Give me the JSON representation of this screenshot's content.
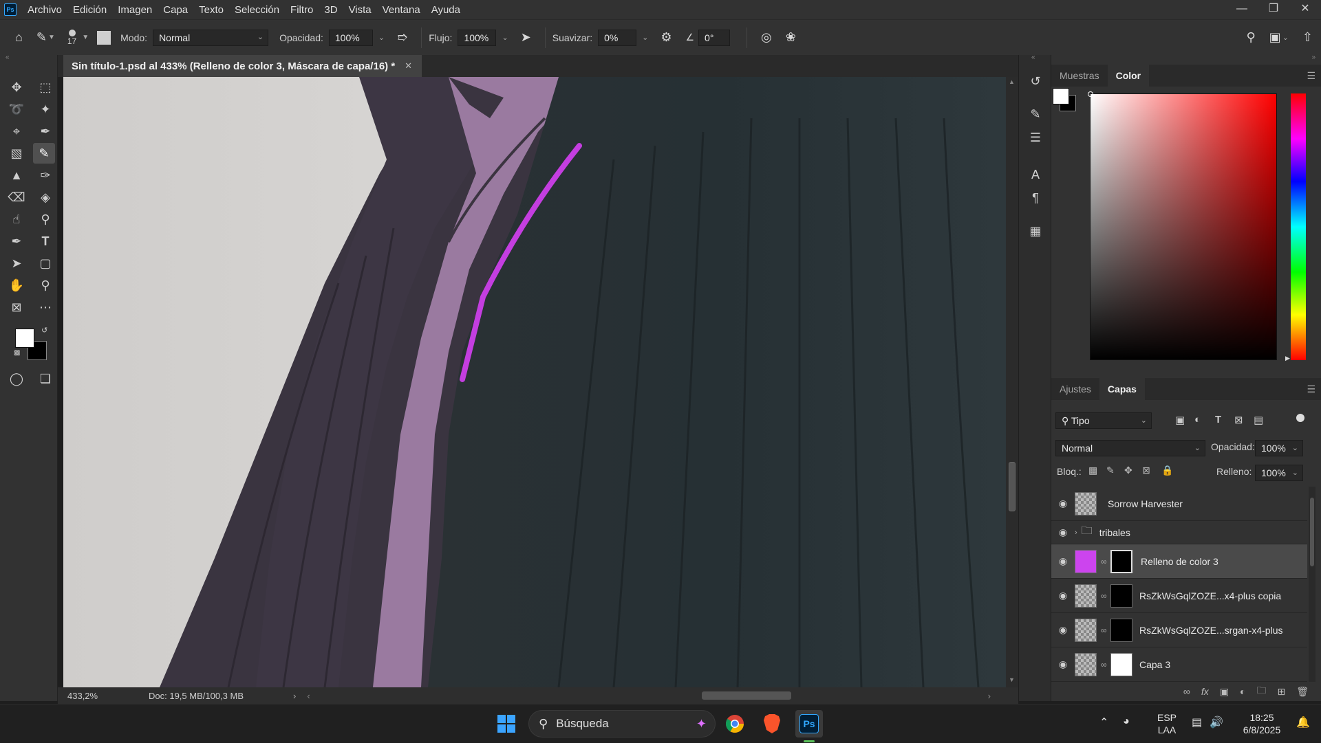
{
  "menubar": {
    "items": [
      "Archivo",
      "Edición",
      "Imagen",
      "Capa",
      "Texto",
      "Selección",
      "Filtro",
      "3D",
      "Vista",
      "Ventana",
      "Ayuda"
    ],
    "logo": "Ps"
  },
  "optionsbar": {
    "brush_size": "17",
    "mode_label": "Modo:",
    "mode_value": "Normal",
    "opacity_label": "Opacidad:",
    "opacity_value": "100%",
    "flow_label": "Flujo:",
    "flow_value": "100%",
    "smoothing_label": "Suavizar:",
    "smoothing_value": "0%",
    "angle_value": "0°"
  },
  "document": {
    "tab_title": "Sin título-1.psd al 433% (Relleno de color 3, Máscara de capa/16) *",
    "zoom": "433,2%",
    "doc_info": "Doc: 19,5 MB/100,3 MB"
  },
  "color_panel": {
    "tabs": [
      "Muestras",
      "Color"
    ],
    "active_tab": "Color"
  },
  "layers_panel": {
    "tabs": [
      "Ajustes",
      "Capas"
    ],
    "active_tab": "Capas",
    "filter_label": "Tipo",
    "blend_mode": "Normal",
    "opacity_label": "Opacidad:",
    "opacity_value": "100%",
    "lock_label": "Bloq.:",
    "fill_label": "Relleno:",
    "fill_value": "100%",
    "layers": [
      {
        "name": "Sorrow Harvester",
        "selected": false
      },
      {
        "name": "tribales",
        "selected": false
      },
      {
        "name": "Relleno de color 3",
        "selected": true
      },
      {
        "name": "RsZkWsGqlZOZE...x4-plus copia",
        "selected": false
      },
      {
        "name": "RsZkWsGqlZOZE...srgan-x4-plus",
        "selected": false
      },
      {
        "name": "Capa 3",
        "selected": false
      }
    ]
  },
  "taskbar": {
    "search_placeholder": "Búsqueda",
    "lang_top": "ESP",
    "lang_bottom": "LAA",
    "time": "18:25",
    "date": "6/8/2025",
    "ps_label": "Ps"
  },
  "colors": {
    "fill_layer": "#cc44ee",
    "accent": "#31a8ff"
  }
}
